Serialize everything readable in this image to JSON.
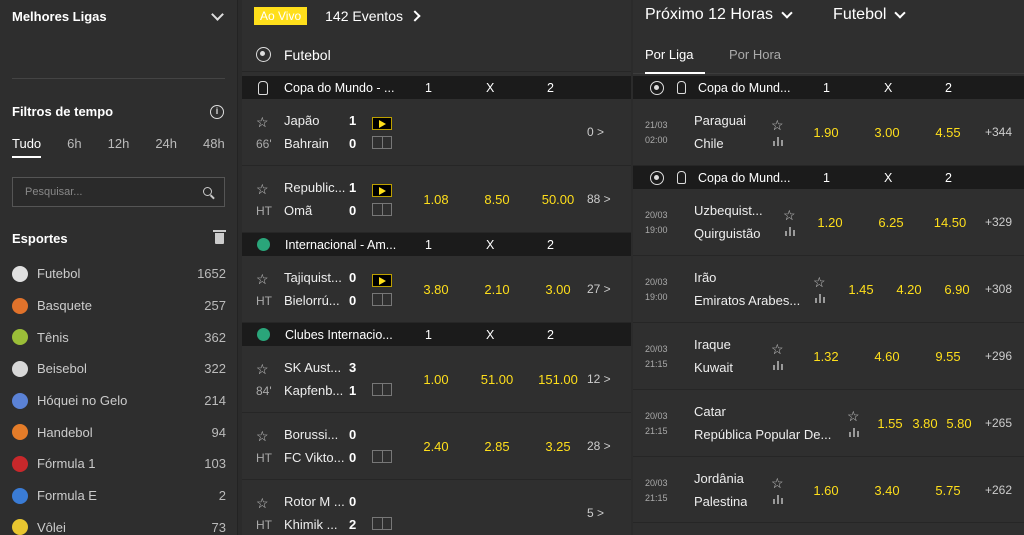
{
  "sidebar": {
    "top_title": "Melhores Ligas",
    "time_filter_title": "Filtros de tempo",
    "time_tabs": [
      "Tudo",
      "6h",
      "12h",
      "24h",
      "48h"
    ],
    "search_placeholder": "Pesquisar...",
    "sports_title": "Esportes",
    "sports": [
      {
        "name": "Futebol",
        "count": "1652",
        "color": "#e0e0e0"
      },
      {
        "name": "Basquete",
        "count": "257",
        "color": "#e0722b"
      },
      {
        "name": "Tênis",
        "count": "362",
        "color": "#9bbe38"
      },
      {
        "name": "Beisebol",
        "count": "322",
        "color": "#d8d8d8"
      },
      {
        "name": "Hóquei no Gelo",
        "count": "214",
        "color": "#5b82d6"
      },
      {
        "name": "Handebol",
        "count": "94",
        "color": "#e47c29"
      },
      {
        "name": "Fórmula 1",
        "count": "103",
        "color": "#c8282b"
      },
      {
        "name": "Formula E",
        "count": "2",
        "color": "#3a7cd6"
      },
      {
        "name": "Vôlei",
        "count": "73",
        "color": "#e8c630"
      }
    ]
  },
  "live": {
    "badge": "Ao Vivo",
    "events_count": "142 Eventos",
    "sport": "Futebol",
    "competitions": [
      {
        "name": "Copa do Mundo - ...",
        "h1": "1",
        "hx": "X",
        "h2": "2"
      },
      {
        "name": "Internacional - Am...",
        "h1": "1",
        "hx": "X",
        "h2": "2"
      },
      {
        "name": "Clubes Internacio...",
        "h1": "1",
        "hx": "X",
        "h2": "2"
      }
    ],
    "matches": [
      {
        "time": "66'",
        "team1": "Japão",
        "team2": "Bahrain",
        "score1": "1",
        "score2": "0",
        "odd1": "",
        "oddx": "",
        "odd2": "",
        "more": "0 >"
      },
      {
        "time": "HT",
        "team1": "Republic...",
        "team2": "Omã",
        "score1": "1",
        "score2": "0",
        "odd1": "1.08",
        "oddx": "8.50",
        "odd2": "50.00",
        "more": "88 >"
      },
      {
        "time": "HT",
        "team1": "Tajiquist...",
        "team2": "Bielorrú...",
        "score1": "0",
        "score2": "0",
        "odd1": "3.80",
        "oddx": "2.10",
        "odd2": "3.00",
        "more": "27 >"
      },
      {
        "time": "84'",
        "team1": "SK Aust...",
        "team2": "Kapfenb...",
        "score1": "3",
        "score2": "1",
        "odd1": "1.00",
        "oddx": "51.00",
        "odd2": "151.00",
        "more": "12 >"
      },
      {
        "time": "HT",
        "team1": "Borussi...",
        "team2": "FC Vikto...",
        "score1": "0",
        "score2": "0",
        "odd1": "2.40",
        "oddx": "2.85",
        "odd2": "3.25",
        "more": "28 >"
      },
      {
        "time": "HT",
        "team1": "Rotor M ...",
        "team2": "Khimik ...",
        "score1": "0",
        "score2": "2",
        "odd1": "",
        "oddx": "",
        "odd2": "",
        "more": "5 >"
      }
    ]
  },
  "next": {
    "period": "Próximo 12 Horas",
    "sport": "Futebol",
    "tabs": [
      "Por Liga",
      "Por Hora"
    ],
    "competitions": [
      {
        "name": "Copa do Mund...",
        "h1": "1",
        "hx": "X",
        "h2": "2"
      },
      {
        "name": "Copa do Mund...",
        "h1": "1",
        "hx": "X",
        "h2": "2"
      }
    ],
    "matches": [
      {
        "date": "21/03",
        "hour": "02:00",
        "team1": "Paraguai",
        "team2": "Chile",
        "odd1": "1.90",
        "oddx": "3.00",
        "odd2": "4.55",
        "more": "+344"
      },
      {
        "date": "20/03",
        "hour": "19:00",
        "team1": "Uzbequist...",
        "team2": "Quirguistão",
        "odd1": "1.20",
        "oddx": "6.25",
        "odd2": "14.50",
        "more": "+329"
      },
      {
        "date": "20/03",
        "hour": "19:00",
        "team1": "Irão",
        "team2": "Emiratos Arabes...",
        "odd1": "1.45",
        "oddx": "4.20",
        "odd2": "6.90",
        "more": "+308"
      },
      {
        "date": "20/03",
        "hour": "21:15",
        "team1": "Iraque",
        "team2": "Kuwait",
        "odd1": "1.32",
        "oddx": "4.60",
        "odd2": "9.55",
        "more": "+296"
      },
      {
        "date": "20/03",
        "hour": "21:15",
        "team1": "Catar",
        "team2": "República Popular De...",
        "odd1": "1.55",
        "oddx": "3.80",
        "odd2": "5.80",
        "more": "+265"
      },
      {
        "date": "20/03",
        "hour": "21:15",
        "team1": "Jordânia",
        "team2": "Palestina",
        "odd1": "1.60",
        "oddx": "3.40",
        "odd2": "5.75",
        "more": "+262"
      }
    ]
  }
}
